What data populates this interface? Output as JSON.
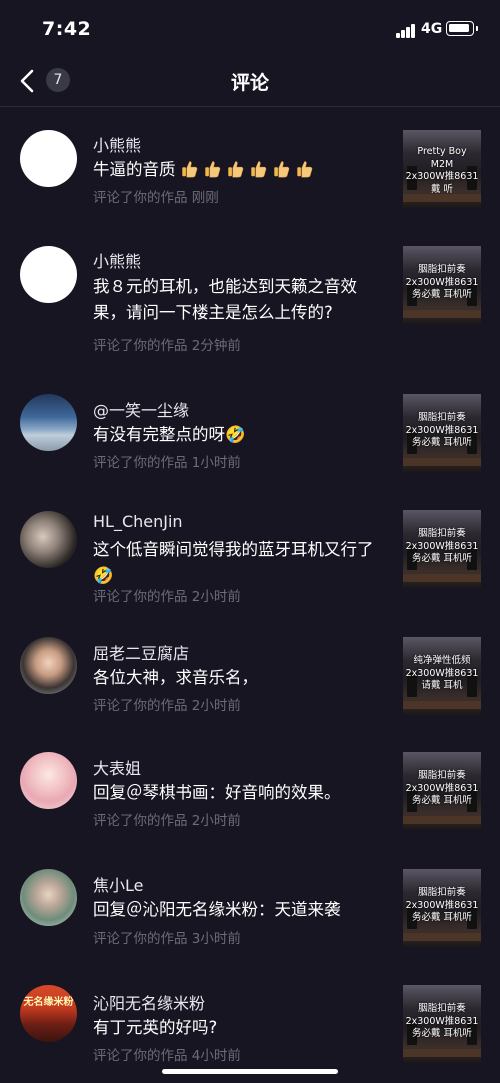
{
  "status": {
    "time": "7:42",
    "network": "4G"
  },
  "header": {
    "title": "评论",
    "count": "7"
  },
  "comments": [
    {
      "name": "小熊熊",
      "text": "牛逼的音质",
      "emoji_count": 6,
      "meta": "评论了你的作品  刚刚",
      "thumb_lines": [
        "Pretty Boy",
        "M2M",
        "2x300W推8631",
        "戴    听"
      ]
    },
    {
      "name": "小熊熊",
      "text": "我８元的耳机，也能达到天籁之音效果，请问一下楼主是怎么上传的?",
      "meta": "评论了你的作品  2分钟前",
      "thumb_lines": [
        "胭脂扣前奏",
        "2x300W推8631",
        "务必戴    耳机听"
      ]
    },
    {
      "name": "@一笑一尘缘",
      "text": "有没有完整点的呀🤣",
      "meta": "评论了你的作品  1小时前",
      "thumb_lines": [
        "胭脂扣前奏",
        "2x300W推8631",
        "务必戴    耳机听"
      ]
    },
    {
      "name": "HL_ChenJin",
      "text": "这个低音瞬间觉得我的蓝牙耳机又行了🤣",
      "meta": "评论了你的作品  2小时前",
      "thumb_lines": [
        "胭脂扣前奏",
        "2x300W推8631",
        "务必戴    耳机听"
      ]
    },
    {
      "name": "屈老二豆腐店",
      "text": "各位大神，求音乐名，",
      "meta": "评论了你的作品  2小时前",
      "thumb_lines": [
        "纯净弹性低频",
        "2x300W推8631",
        "请戴    耳机"
      ]
    },
    {
      "name": "大表姐",
      "text": "回复＠琴棋书画：好音响的效果。",
      "meta": "评论了你的作品  2小时前",
      "thumb_lines": [
        "胭脂扣前奏",
        "2x300W推8631",
        "务必戴    耳机听"
      ]
    },
    {
      "name": "焦小Le",
      "text": "回复＠沁阳无名缘米粉：天道来袭",
      "meta": "评论了你的作品  3小时前",
      "thumb_lines": [
        "胭脂扣前奏",
        "2x300W推8631",
        "务必戴    耳机听"
      ]
    },
    {
      "name": "沁阳无名缘米粉",
      "text": "有丁元英的好吗?",
      "meta": "评论了你的作品  4小时前",
      "thumb_lines": [
        "胭脂扣前奏",
        "2x300W推8631",
        "务必戴    耳机听"
      ],
      "avatar_text": "无名缘米粉"
    }
  ]
}
